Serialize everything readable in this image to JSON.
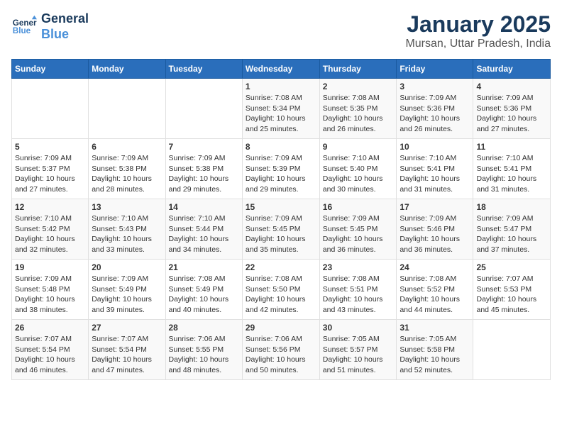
{
  "logo": {
    "line1": "General",
    "line2": "Blue"
  },
  "title": "January 2025",
  "subtitle": "Mursan, Uttar Pradesh, India",
  "weekdays": [
    "Sunday",
    "Monday",
    "Tuesday",
    "Wednesday",
    "Thursday",
    "Friday",
    "Saturday"
  ],
  "weeks": [
    [
      {
        "num": "",
        "sunrise": "",
        "sunset": "",
        "daylight": ""
      },
      {
        "num": "",
        "sunrise": "",
        "sunset": "",
        "daylight": ""
      },
      {
        "num": "",
        "sunrise": "",
        "sunset": "",
        "daylight": ""
      },
      {
        "num": "1",
        "sunrise": "Sunrise: 7:08 AM",
        "sunset": "Sunset: 5:34 PM",
        "daylight": "Daylight: 10 hours and 25 minutes."
      },
      {
        "num": "2",
        "sunrise": "Sunrise: 7:08 AM",
        "sunset": "Sunset: 5:35 PM",
        "daylight": "Daylight: 10 hours and 26 minutes."
      },
      {
        "num": "3",
        "sunrise": "Sunrise: 7:09 AM",
        "sunset": "Sunset: 5:36 PM",
        "daylight": "Daylight: 10 hours and 26 minutes."
      },
      {
        "num": "4",
        "sunrise": "Sunrise: 7:09 AM",
        "sunset": "Sunset: 5:36 PM",
        "daylight": "Daylight: 10 hours and 27 minutes."
      }
    ],
    [
      {
        "num": "5",
        "sunrise": "Sunrise: 7:09 AM",
        "sunset": "Sunset: 5:37 PM",
        "daylight": "Daylight: 10 hours and 27 minutes."
      },
      {
        "num": "6",
        "sunrise": "Sunrise: 7:09 AM",
        "sunset": "Sunset: 5:38 PM",
        "daylight": "Daylight: 10 hours and 28 minutes."
      },
      {
        "num": "7",
        "sunrise": "Sunrise: 7:09 AM",
        "sunset": "Sunset: 5:38 PM",
        "daylight": "Daylight: 10 hours and 29 minutes."
      },
      {
        "num": "8",
        "sunrise": "Sunrise: 7:09 AM",
        "sunset": "Sunset: 5:39 PM",
        "daylight": "Daylight: 10 hours and 29 minutes."
      },
      {
        "num": "9",
        "sunrise": "Sunrise: 7:10 AM",
        "sunset": "Sunset: 5:40 PM",
        "daylight": "Daylight: 10 hours and 30 minutes."
      },
      {
        "num": "10",
        "sunrise": "Sunrise: 7:10 AM",
        "sunset": "Sunset: 5:41 PM",
        "daylight": "Daylight: 10 hours and 31 minutes."
      },
      {
        "num": "11",
        "sunrise": "Sunrise: 7:10 AM",
        "sunset": "Sunset: 5:41 PM",
        "daylight": "Daylight: 10 hours and 31 minutes."
      }
    ],
    [
      {
        "num": "12",
        "sunrise": "Sunrise: 7:10 AM",
        "sunset": "Sunset: 5:42 PM",
        "daylight": "Daylight: 10 hours and 32 minutes."
      },
      {
        "num": "13",
        "sunrise": "Sunrise: 7:10 AM",
        "sunset": "Sunset: 5:43 PM",
        "daylight": "Daylight: 10 hours and 33 minutes."
      },
      {
        "num": "14",
        "sunrise": "Sunrise: 7:10 AM",
        "sunset": "Sunset: 5:44 PM",
        "daylight": "Daylight: 10 hours and 34 minutes."
      },
      {
        "num": "15",
        "sunrise": "Sunrise: 7:09 AM",
        "sunset": "Sunset: 5:45 PM",
        "daylight": "Daylight: 10 hours and 35 minutes."
      },
      {
        "num": "16",
        "sunrise": "Sunrise: 7:09 AM",
        "sunset": "Sunset: 5:45 PM",
        "daylight": "Daylight: 10 hours and 36 minutes."
      },
      {
        "num": "17",
        "sunrise": "Sunrise: 7:09 AM",
        "sunset": "Sunset: 5:46 PM",
        "daylight": "Daylight: 10 hours and 36 minutes."
      },
      {
        "num": "18",
        "sunrise": "Sunrise: 7:09 AM",
        "sunset": "Sunset: 5:47 PM",
        "daylight": "Daylight: 10 hours and 37 minutes."
      }
    ],
    [
      {
        "num": "19",
        "sunrise": "Sunrise: 7:09 AM",
        "sunset": "Sunset: 5:48 PM",
        "daylight": "Daylight: 10 hours and 38 minutes."
      },
      {
        "num": "20",
        "sunrise": "Sunrise: 7:09 AM",
        "sunset": "Sunset: 5:49 PM",
        "daylight": "Daylight: 10 hours and 39 minutes."
      },
      {
        "num": "21",
        "sunrise": "Sunrise: 7:08 AM",
        "sunset": "Sunset: 5:49 PM",
        "daylight": "Daylight: 10 hours and 40 minutes."
      },
      {
        "num": "22",
        "sunrise": "Sunrise: 7:08 AM",
        "sunset": "Sunset: 5:50 PM",
        "daylight": "Daylight: 10 hours and 42 minutes."
      },
      {
        "num": "23",
        "sunrise": "Sunrise: 7:08 AM",
        "sunset": "Sunset: 5:51 PM",
        "daylight": "Daylight: 10 hours and 43 minutes."
      },
      {
        "num": "24",
        "sunrise": "Sunrise: 7:08 AM",
        "sunset": "Sunset: 5:52 PM",
        "daylight": "Daylight: 10 hours and 44 minutes."
      },
      {
        "num": "25",
        "sunrise": "Sunrise: 7:07 AM",
        "sunset": "Sunset: 5:53 PM",
        "daylight": "Daylight: 10 hours and 45 minutes."
      }
    ],
    [
      {
        "num": "26",
        "sunrise": "Sunrise: 7:07 AM",
        "sunset": "Sunset: 5:54 PM",
        "daylight": "Daylight: 10 hours and 46 minutes."
      },
      {
        "num": "27",
        "sunrise": "Sunrise: 7:07 AM",
        "sunset": "Sunset: 5:54 PM",
        "daylight": "Daylight: 10 hours and 47 minutes."
      },
      {
        "num": "28",
        "sunrise": "Sunrise: 7:06 AM",
        "sunset": "Sunset: 5:55 PM",
        "daylight": "Daylight: 10 hours and 48 minutes."
      },
      {
        "num": "29",
        "sunrise": "Sunrise: 7:06 AM",
        "sunset": "Sunset: 5:56 PM",
        "daylight": "Daylight: 10 hours and 50 minutes."
      },
      {
        "num": "30",
        "sunrise": "Sunrise: 7:05 AM",
        "sunset": "Sunset: 5:57 PM",
        "daylight": "Daylight: 10 hours and 51 minutes."
      },
      {
        "num": "31",
        "sunrise": "Sunrise: 7:05 AM",
        "sunset": "Sunset: 5:58 PM",
        "daylight": "Daylight: 10 hours and 52 minutes."
      },
      {
        "num": "",
        "sunrise": "",
        "sunset": "",
        "daylight": ""
      }
    ]
  ]
}
